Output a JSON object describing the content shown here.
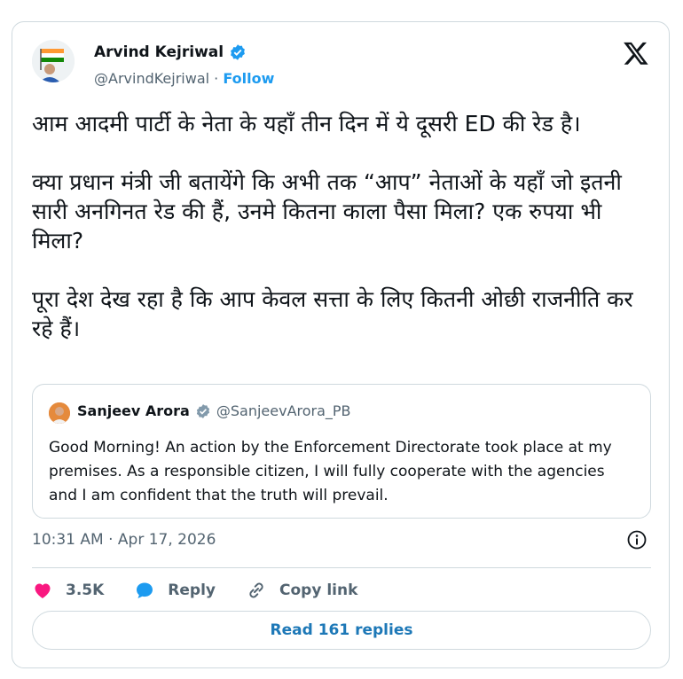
{
  "author": {
    "name": "Arvind Kejriwal",
    "handle": "@ArvindKejriwal",
    "separator": " · ",
    "follow_label": "Follow"
  },
  "tweet": {
    "text": "आम आदमी पार्टी के नेता के यहाँ तीन दिन में ये दूसरी ED की रेड है।\n\nक्या प्रधान मंत्री जी बतायेंगे कि अभी तक “आप” नेताओं के यहाँ जो इतनी सारी अनगिनत रेड की हैं, उनमे कितना काला पैसा मिला? एक रुपया भी मिला?\n\nपूरा देश देख रहा है कि आप केवल सत्ता के लिए कितनी ओछी राजनीति कर रहे हैं।",
    "timestamp": "10:31 AM · Apr 17, 2026"
  },
  "quote": {
    "name": "Sanjeev Arora",
    "handle": "@SanjeevArora_PB",
    "text": "Good Morning! An action by the Enforcement Directorate took place at my premises. As a responsible citizen, I will fully cooperate with the agencies and I am confident that the truth will prevail."
  },
  "actions": {
    "likes": "3.5K",
    "reply_label": "Reply",
    "copy_link_label": "Copy link"
  },
  "read_replies_label": "Read 161 replies",
  "colors": {
    "accent": "#1d9bf0",
    "like": "#f91880",
    "muted": "#536471",
    "border": "#cfd9de"
  },
  "icons": [
    "verified-badge-icon",
    "x-logo-icon",
    "info-icon",
    "heart-icon",
    "reply-bubble-icon",
    "link-icon"
  ]
}
